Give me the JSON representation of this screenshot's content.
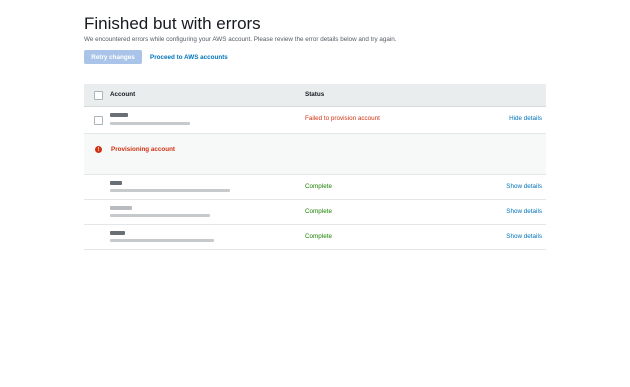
{
  "header": {
    "title": "Finished but with errors",
    "subtitle": "We encountered errors while configuring your AWS account. Please review the error details below and try again."
  },
  "actions": {
    "retry_label": "Retry changes",
    "proceed_label": "Proceed to AWS accounts"
  },
  "table": {
    "columns": {
      "account": "Account",
      "status": "Status"
    },
    "rows": [
      {
        "status": "Failed to provision account",
        "details": "Hide details",
        "status_type": "failed"
      },
      {
        "status": "Complete",
        "details": "Show details",
        "status_type": "ok"
      },
      {
        "status": "Complete",
        "details": "Show details",
        "status_type": "ok"
      },
      {
        "status": "Complete",
        "details": "Show details",
        "status_type": "ok"
      }
    ],
    "error_panel": {
      "icon": "error-icon",
      "message": "Provisioning account"
    }
  },
  "colors": {
    "primary_disabled": "#a9c4e8",
    "link": "#0073bb",
    "error": "#d13212",
    "success": "#1d8102"
  }
}
